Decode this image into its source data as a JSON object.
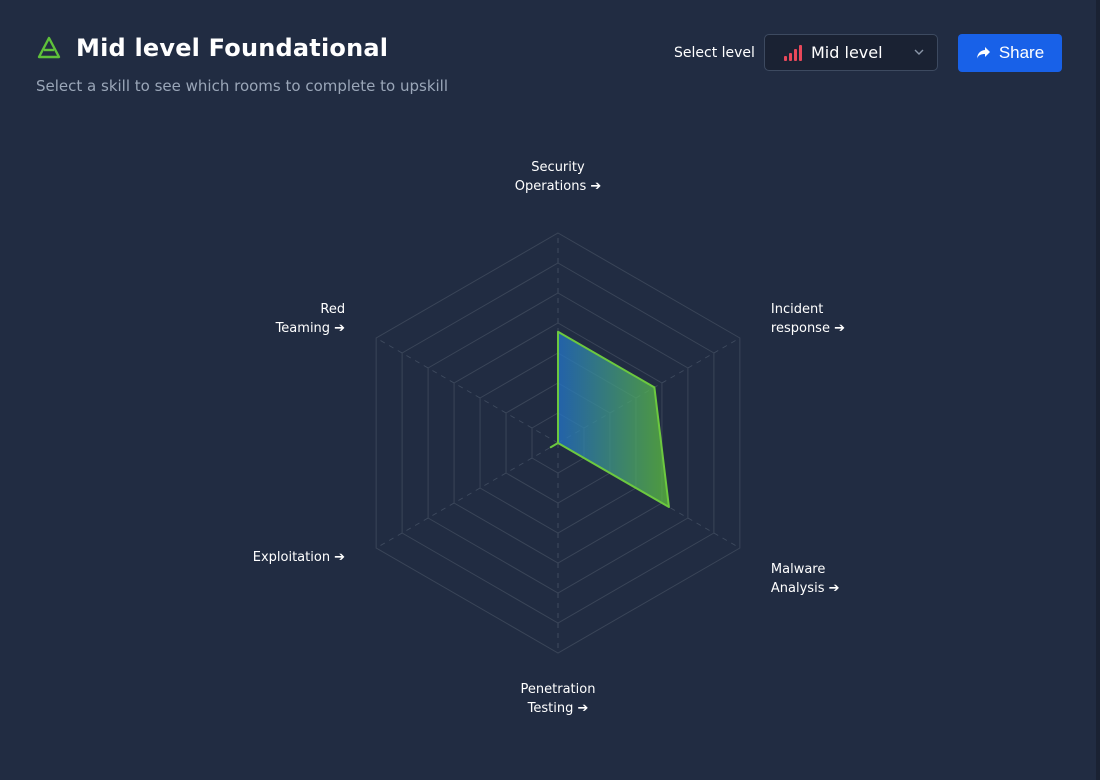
{
  "header": {
    "title": "Mid level Foundational",
    "subtitle": "Select a skill to see which rooms to complete to upskill",
    "logo_icon": "layered-triangle-icon"
  },
  "controls": {
    "select_label": "Select level",
    "level_value": "Mid level",
    "level_icon": "signal-bars-icon",
    "share_label": "Share",
    "share_icon": "share-arrow-icon"
  },
  "colors": {
    "background": "#212c42",
    "accent_green": "#5fc13a",
    "share_blue": "#1861e8",
    "level_bars": "#e8485a"
  },
  "chart_data": {
    "type": "radar",
    "axes": [
      {
        "line1": "Security",
        "line2": "Operations ➔"
      },
      {
        "line1": "Incident",
        "line2": "response ➔"
      },
      {
        "line1": "Malware",
        "line2": "Analysis ➔"
      },
      {
        "line1": "Penetration",
        "line2": "Testing ➔"
      },
      {
        "line1": "Exploitation ➔",
        "line2": ""
      },
      {
        "line1": "Red",
        "line2": "Teaming ➔"
      }
    ],
    "values": [
      0.53,
      0.53,
      0.61,
      0,
      0.04,
      0
    ],
    "rings": 7,
    "max": 1
  }
}
